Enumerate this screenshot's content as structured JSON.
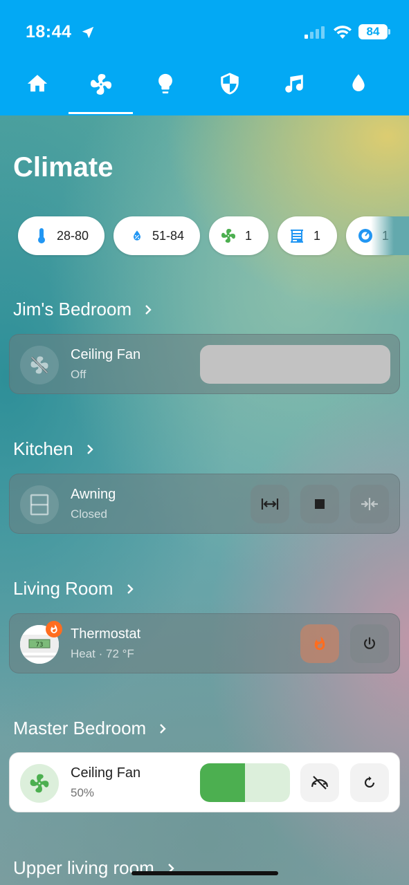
{
  "status_bar": {
    "time": "18:44",
    "battery": "84"
  },
  "tabs": [
    {
      "name": "home-icon"
    },
    {
      "name": "fan-icon",
      "selected": true
    },
    {
      "name": "lightbulb-icon"
    },
    {
      "name": "shield-icon"
    },
    {
      "name": "music-icon"
    },
    {
      "name": "water-drop-icon"
    }
  ],
  "page": {
    "title": "Climate"
  },
  "chips": [
    {
      "icon": "thermometer-icon",
      "value": "28-80"
    },
    {
      "icon": "humidity-icon",
      "value": "51-84"
    },
    {
      "icon": "fan-icon",
      "value": "1"
    },
    {
      "icon": "window-shutter-icon",
      "value": "1"
    },
    {
      "icon": "thermostat-dial-icon",
      "value": "1"
    }
  ],
  "areas": [
    {
      "title": "Jim's Bedroom",
      "device": {
        "name": "Ceiling Fan",
        "state": "Off"
      }
    },
    {
      "title": "Kitchen",
      "device": {
        "name": "Awning",
        "state": "Closed"
      }
    },
    {
      "title": "Living Room",
      "device": {
        "name": "Thermostat",
        "state": "Heat · 72 °F",
        "display": "73"
      }
    },
    {
      "title": "Master Bedroom",
      "device": {
        "name": "Ceiling Fan",
        "state": "50%",
        "level": 0.5
      }
    },
    {
      "title": "Upper living room"
    }
  ],
  "colors": {
    "header": "#03a9f4",
    "fan_green": "#4caf50",
    "heat_orange": "#ff6d1f",
    "chip_blue": "#2196f3"
  }
}
